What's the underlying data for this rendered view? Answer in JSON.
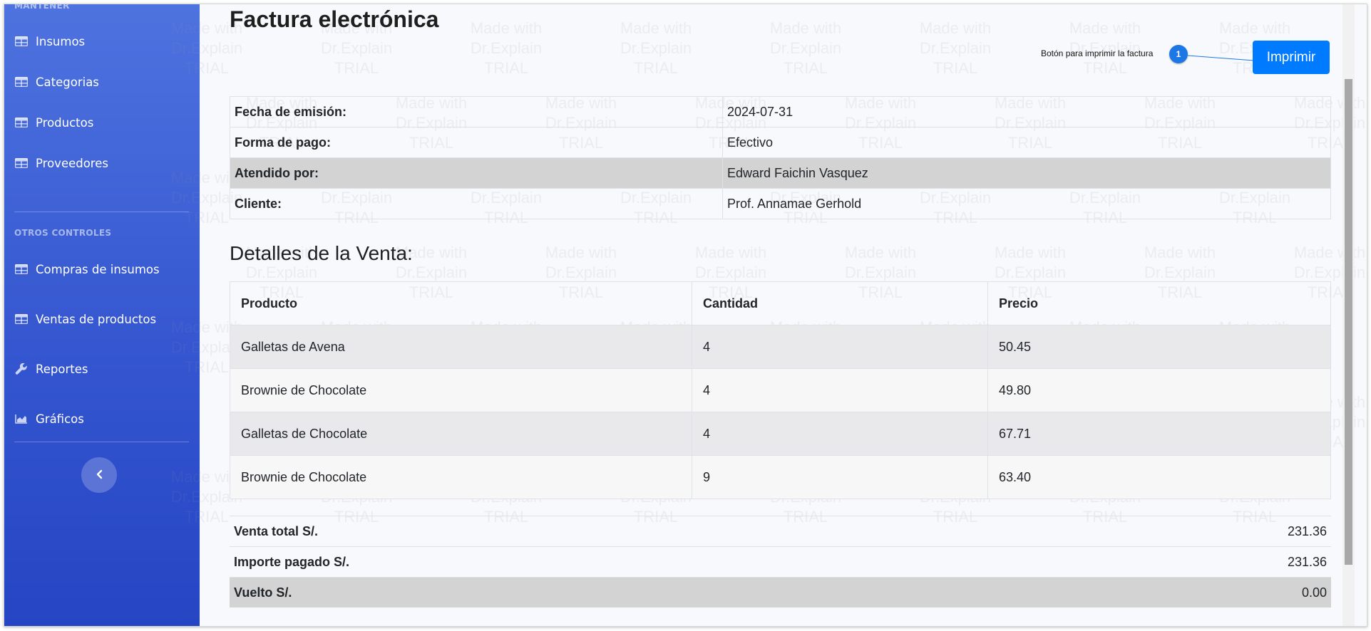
{
  "sidebar": {
    "heading_top": "MANTENER",
    "items_top": [
      {
        "label": "Insumos",
        "icon": "table-icon"
      },
      {
        "label": "Categorias",
        "icon": "table-icon"
      },
      {
        "label": "Productos",
        "icon": "table-icon"
      },
      {
        "label": "Proveedores",
        "icon": "table-icon"
      }
    ],
    "heading_other": "OTROS CONTROLES",
    "items_other": [
      {
        "label": "Compras de insumos",
        "icon": "table-icon"
      },
      {
        "label": "Ventas de productos",
        "icon": "table-icon"
      },
      {
        "label": "Reportes",
        "icon": "wrench-icon"
      },
      {
        "label": "Gráficos",
        "icon": "area-chart-icon"
      }
    ],
    "toggle_icon": "chevron-left-icon"
  },
  "page": {
    "title": "Factura electrónica",
    "print_button": "Imprimir",
    "callout_text": "Botón para imprimir la factura",
    "callout_number": "1"
  },
  "info": {
    "rows": [
      {
        "label": "Fecha de emisión:",
        "value": "2024-07-31"
      },
      {
        "label": "Forma de pago:",
        "value": "Efectivo"
      },
      {
        "label": "Atendido por:",
        "value": "Edward Faichin Vasquez"
      },
      {
        "label": "Cliente:",
        "value": "Prof. Annamae Gerhold"
      }
    ]
  },
  "details": {
    "title": "Detalles de la Venta:",
    "headers": [
      "Producto",
      "Cantidad",
      "Precio"
    ],
    "rows": [
      {
        "product": "Galletas de Avena",
        "qty": "4",
        "price": "50.45"
      },
      {
        "product": "Brownie de Chocolate",
        "qty": "4",
        "price": "49.80"
      },
      {
        "product": "Galletas de Chocolate",
        "qty": "4",
        "price": "67.71"
      },
      {
        "product": "Brownie de Chocolate",
        "qty": "9",
        "price": "63.40"
      }
    ]
  },
  "totals": {
    "rows": [
      {
        "label": "Venta total S/.",
        "value": "231.36"
      },
      {
        "label": "Importe pagado S/.",
        "value": "231.36"
      },
      {
        "label": "Vuelto S/.",
        "value": "0.00"
      }
    ]
  },
  "watermark": {
    "lines": [
      "Made with",
      "Dr.Explain",
      "TRIAL"
    ]
  },
  "colors": {
    "sidebar_top": "#4e73df",
    "sidebar_bottom": "#2545c4",
    "primary_button": "#007bff",
    "shaded_row": "#d3d3d3"
  }
}
